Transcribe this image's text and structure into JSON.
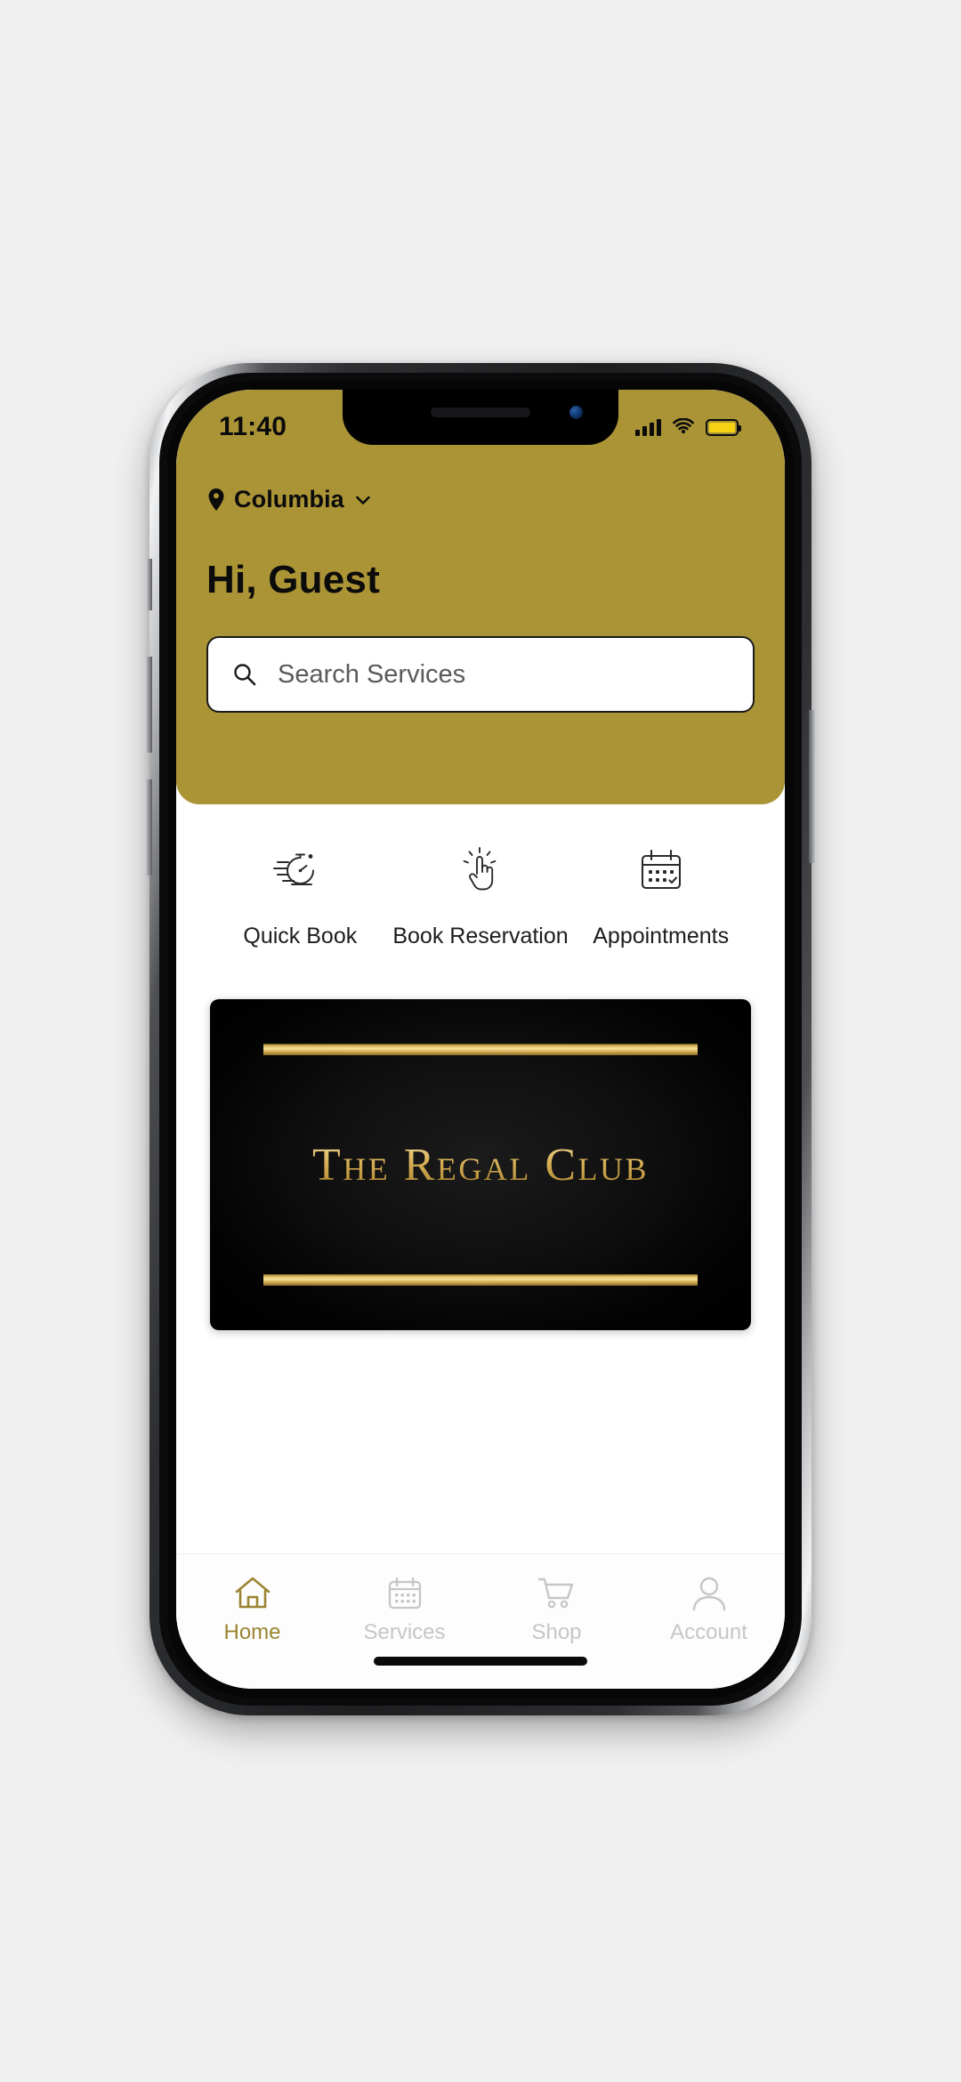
{
  "status_bar": {
    "time": "11:40",
    "signal_icon": "cellular-signal-icon",
    "wifi_icon": "wifi-icon",
    "battery_icon": "battery-icon",
    "battery_color": "#f5d312"
  },
  "header": {
    "background_color": "#ab9436",
    "location_pin_icon": "location-pin-icon",
    "location": "Columbia",
    "location_chevron_icon": "chevron-down-icon",
    "greeting": "Hi, Guest",
    "search": {
      "icon": "search-icon",
      "placeholder": "Search Services",
      "value": ""
    }
  },
  "quick_actions": [
    {
      "label": "Quick Book",
      "icon": "speed-stopwatch-icon"
    },
    {
      "label": "Book Reservation",
      "icon": "tap-hand-icon"
    },
    {
      "label": "Appointments",
      "icon": "calendar-check-icon"
    }
  ],
  "banner": {
    "title": "The Regal Club",
    "background_color": "#000000",
    "accent_color": "#d7b055"
  },
  "bottom_nav": {
    "active_color": "#9a8431",
    "inactive_color": "#c6c6c6",
    "items": [
      {
        "label": "Home",
        "icon": "home-icon",
        "active": true
      },
      {
        "label": "Services",
        "icon": "calendar-icon",
        "active": false
      },
      {
        "label": "Shop",
        "icon": "shopping-cart-icon",
        "active": false
      },
      {
        "label": "Account",
        "icon": "person-icon",
        "active": false
      }
    ]
  }
}
